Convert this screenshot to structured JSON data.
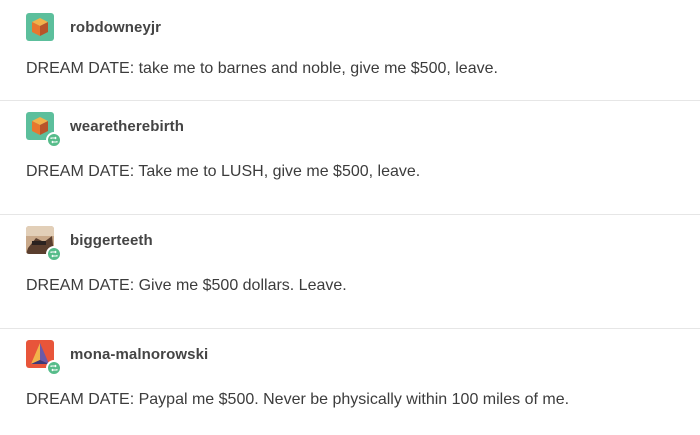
{
  "posts": [
    {
      "username": "robdowneyjr",
      "avatar_icon": "orange-cube-avatar-icon",
      "reblogged": false,
      "text": "DREAM DATE: take me to barnes and noble, give me $500, leave."
    },
    {
      "username": "wearetherebirth",
      "avatar_icon": "orange-cube-avatar-icon",
      "reblogged": true,
      "text": "DREAM DATE: Take me to LUSH, give me $500, leave."
    },
    {
      "username": "biggerteeth",
      "avatar_icon": "photo-avatar-icon",
      "reblogged": true,
      "text": "DREAM DATE: Give me $500 dollars. Leave."
    },
    {
      "username": "mona-malnorowski",
      "avatar_icon": "pyramid-avatar-icon",
      "reblogged": true,
      "text": "DREAM DATE: Paypal me $500. Never be physically within 100 miles of me."
    }
  ],
  "colors": {
    "reblog_badge": "#56bc8a",
    "avatar_teal": "#5cbf9c",
    "avatar_orange": "#e8553a"
  }
}
